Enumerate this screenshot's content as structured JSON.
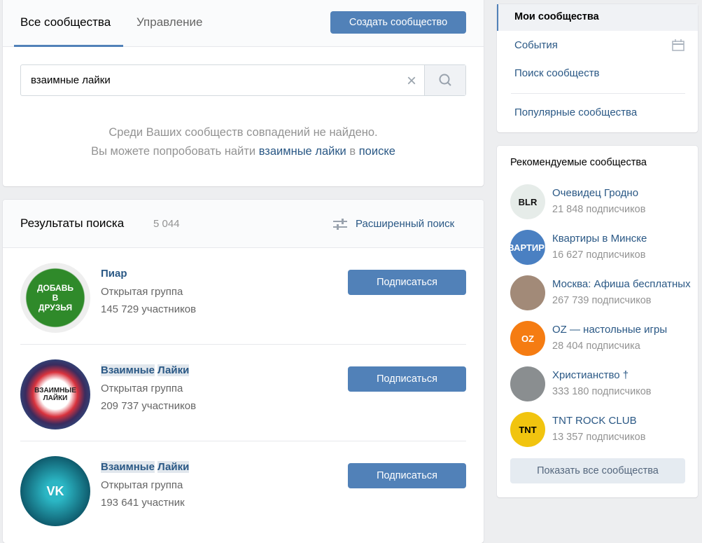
{
  "tabs": {
    "all": "Все сообщества",
    "manage": "Управление"
  },
  "create_button": "Создать сообщество",
  "search": {
    "value": "взаимные лайки"
  },
  "empty": {
    "line1": "Среди Ваших сообществ совпадений не найдено.",
    "line2_prefix": "Вы можете попробовать найти",
    "query_link": "взаимные лайки",
    "in": "в",
    "search_link": "поиске"
  },
  "results": {
    "title": "Результаты поиска",
    "count": "5 044",
    "advanced": "Расширенный поиск",
    "items": [
      {
        "name": "Пиар",
        "type": "Открытая группа",
        "members": "145 729 участников",
        "button": "Подписаться",
        "avatar_text": "ДОБАВЬ В ДРУЗЬЯ"
      },
      {
        "name_a": "Взаимные",
        "name_b": "Лайки",
        "type": "Открытая группа",
        "members": "209 737 участников",
        "button": "Подписаться",
        "avatar_text": "ВЗАИМНЫЕ ЛАЙКИ"
      },
      {
        "name_a": "Взаимные",
        "name_b": "Лайки",
        "type": "Открытая группа",
        "members": "193 641 участник",
        "button": "Подписаться",
        "avatar_text": "VK"
      }
    ]
  },
  "menu": {
    "items": [
      "Мои сообщества",
      "События",
      "Поиск сообществ",
      "Популярные сообщества"
    ]
  },
  "recommended": {
    "title": "Рекомендуемые сообщества",
    "items": [
      {
        "name": "Очевидец Гродно",
        "subs": "21 848 подписчиков",
        "avatar_text": "BLR",
        "color": "#e6ece9"
      },
      {
        "name": "Квартиры в Минске",
        "subs": "16 627 подписчиков",
        "avatar_text": "КВАРТИРЫ",
        "color": "#4a80c2"
      },
      {
        "name": "Москва: Афиша бесплатных",
        "subs": "267 739 подписчиков",
        "avatar_text": "",
        "color": "#a28a78"
      },
      {
        "name": "OZ — настольные игры",
        "subs": "28 404 подписчика",
        "avatar_text": "OZ",
        "color": "#f57c12"
      },
      {
        "name": "Христианство †",
        "subs": "333 180 подписчиков",
        "avatar_text": "",
        "color": "#8a8e90"
      },
      {
        "name": "TNT ROCK CLUB",
        "subs": "13 357 подписчиков",
        "avatar_text": "TNT",
        "color": "#f1c40f"
      }
    ],
    "show_all": "Показать все сообщества"
  }
}
